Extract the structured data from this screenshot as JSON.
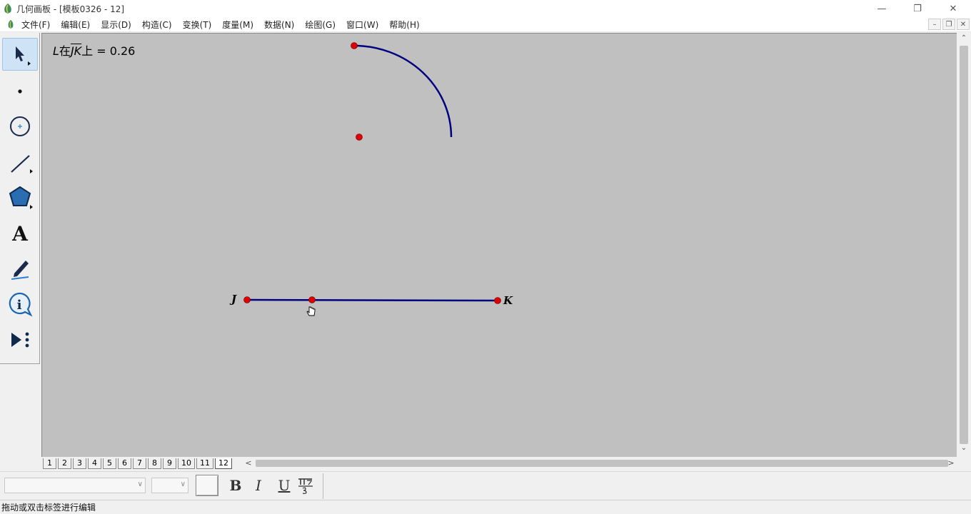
{
  "window": {
    "title": "几何画板 - [模板0326 - 12]",
    "controls": {
      "minimize": "—",
      "restore": "❐",
      "close": "✕"
    }
  },
  "menubar": {
    "items": [
      "文件(F)",
      "编辑(E)",
      "显示(D)",
      "构造(C)",
      "变换(T)",
      "度量(M)",
      "数据(N)",
      "绘图(G)",
      "窗口(W)",
      "帮助(H)"
    ],
    "mdi": {
      "minimize": "–",
      "restore": "❐",
      "close": "✕"
    }
  },
  "toolbox": {
    "tools": [
      "arrow-select",
      "point",
      "compass",
      "straightedge",
      "polygon",
      "text",
      "marker",
      "information",
      "custom-tools"
    ],
    "selected": "arrow-select"
  },
  "canvas": {
    "measurement": {
      "prefix": "L",
      "middle": "在",
      "segment": "JK",
      "suffix": "上 = 0.26"
    },
    "labels": {
      "j": "J",
      "k": "K"
    },
    "colors": {
      "background": "#c0c0c0",
      "stroke": "#000080",
      "point": "#e00000"
    }
  },
  "pages": {
    "tabs": [
      "1",
      "2",
      "3",
      "4",
      "5",
      "6",
      "7",
      "8",
      "9",
      "10",
      "11",
      "12"
    ],
    "active": "12"
  },
  "textbar": {
    "bold": "B",
    "italic": "I",
    "underline": "U"
  },
  "status": {
    "text": "拖动或双击标签进行编辑"
  }
}
